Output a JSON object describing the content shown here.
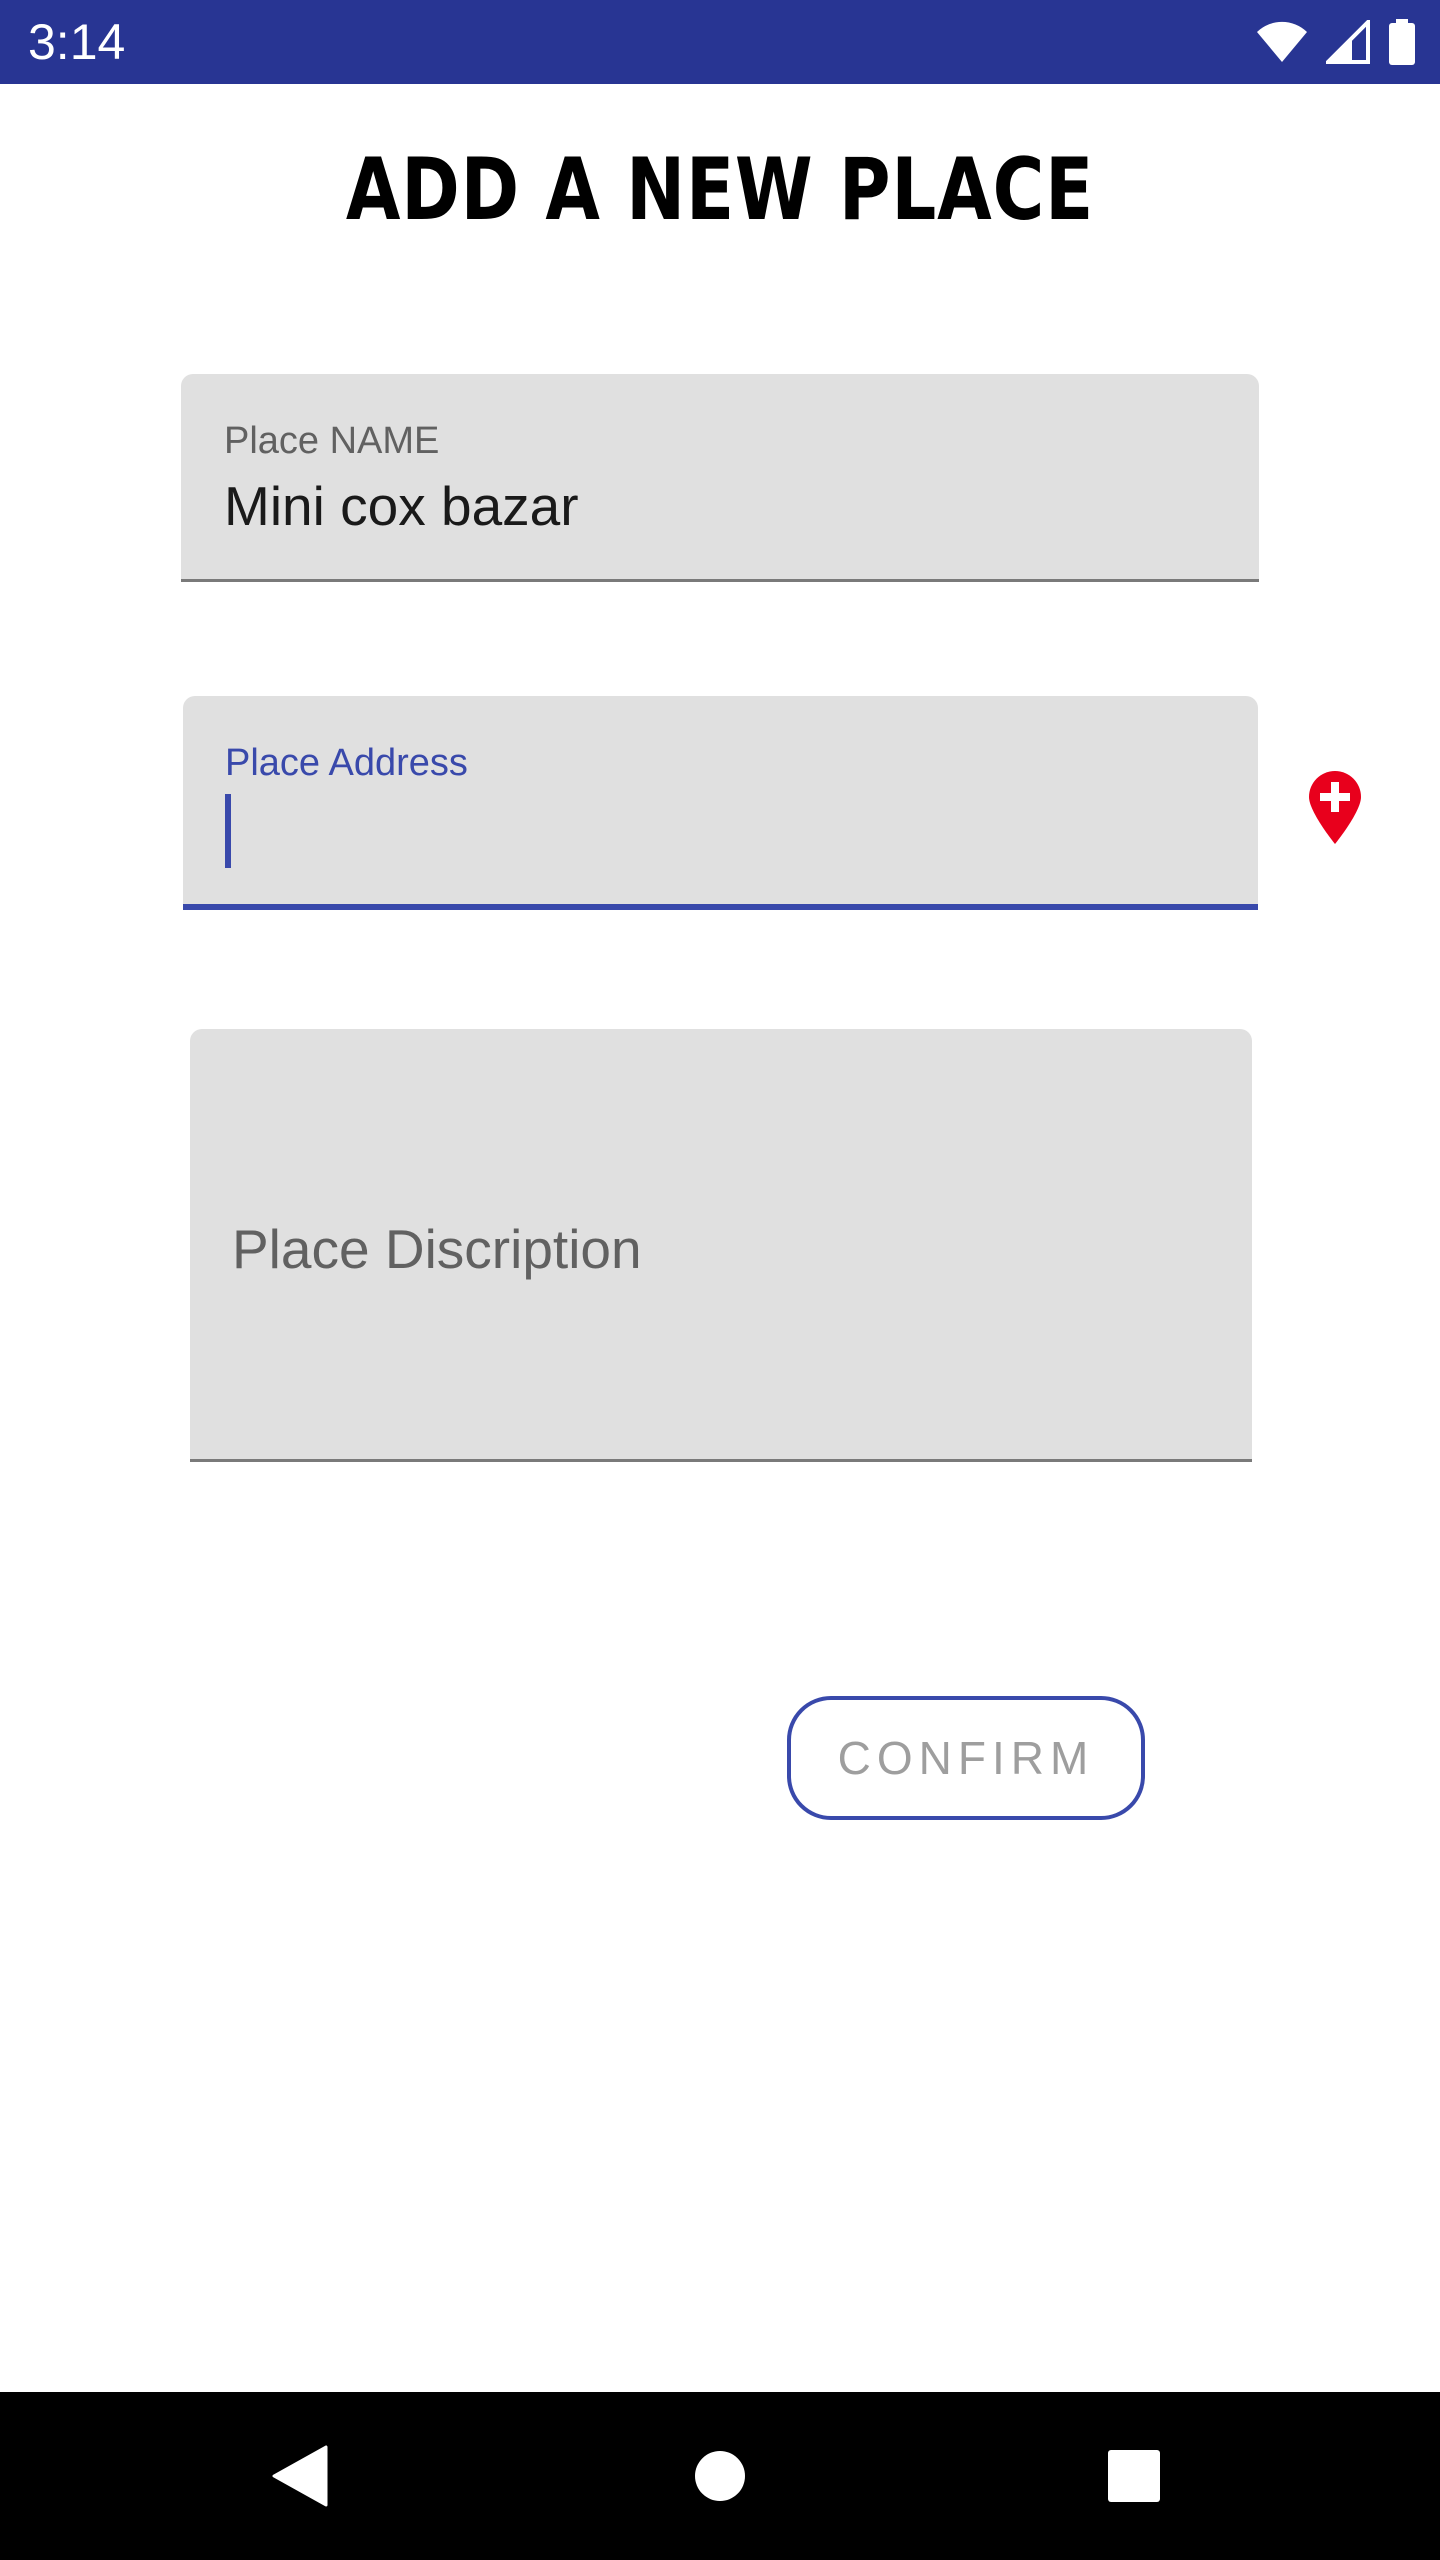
{
  "status_bar": {
    "time": "3:14",
    "background": "#283593",
    "icons": [
      "wifi-icon",
      "cellular-signal-icon",
      "battery-icon"
    ]
  },
  "title": "ADD A NEW PLACE",
  "form": {
    "place_name": {
      "label": "Place NAME",
      "value": "Mini cox bazar"
    },
    "place_address": {
      "label": "Place Address",
      "value": "",
      "focused": true
    },
    "place_description": {
      "placeholder": "Place Discription",
      "value": ""
    },
    "add_location_icon": "add-location-icon",
    "confirm_label": "CONFIRM"
  },
  "colors": {
    "accent": "#3949ab",
    "field_background": "#e0e0e0",
    "location_pin": "#e8001c"
  },
  "nav_bar": {
    "icons": [
      "back-icon",
      "home-icon",
      "recents-icon"
    ]
  }
}
